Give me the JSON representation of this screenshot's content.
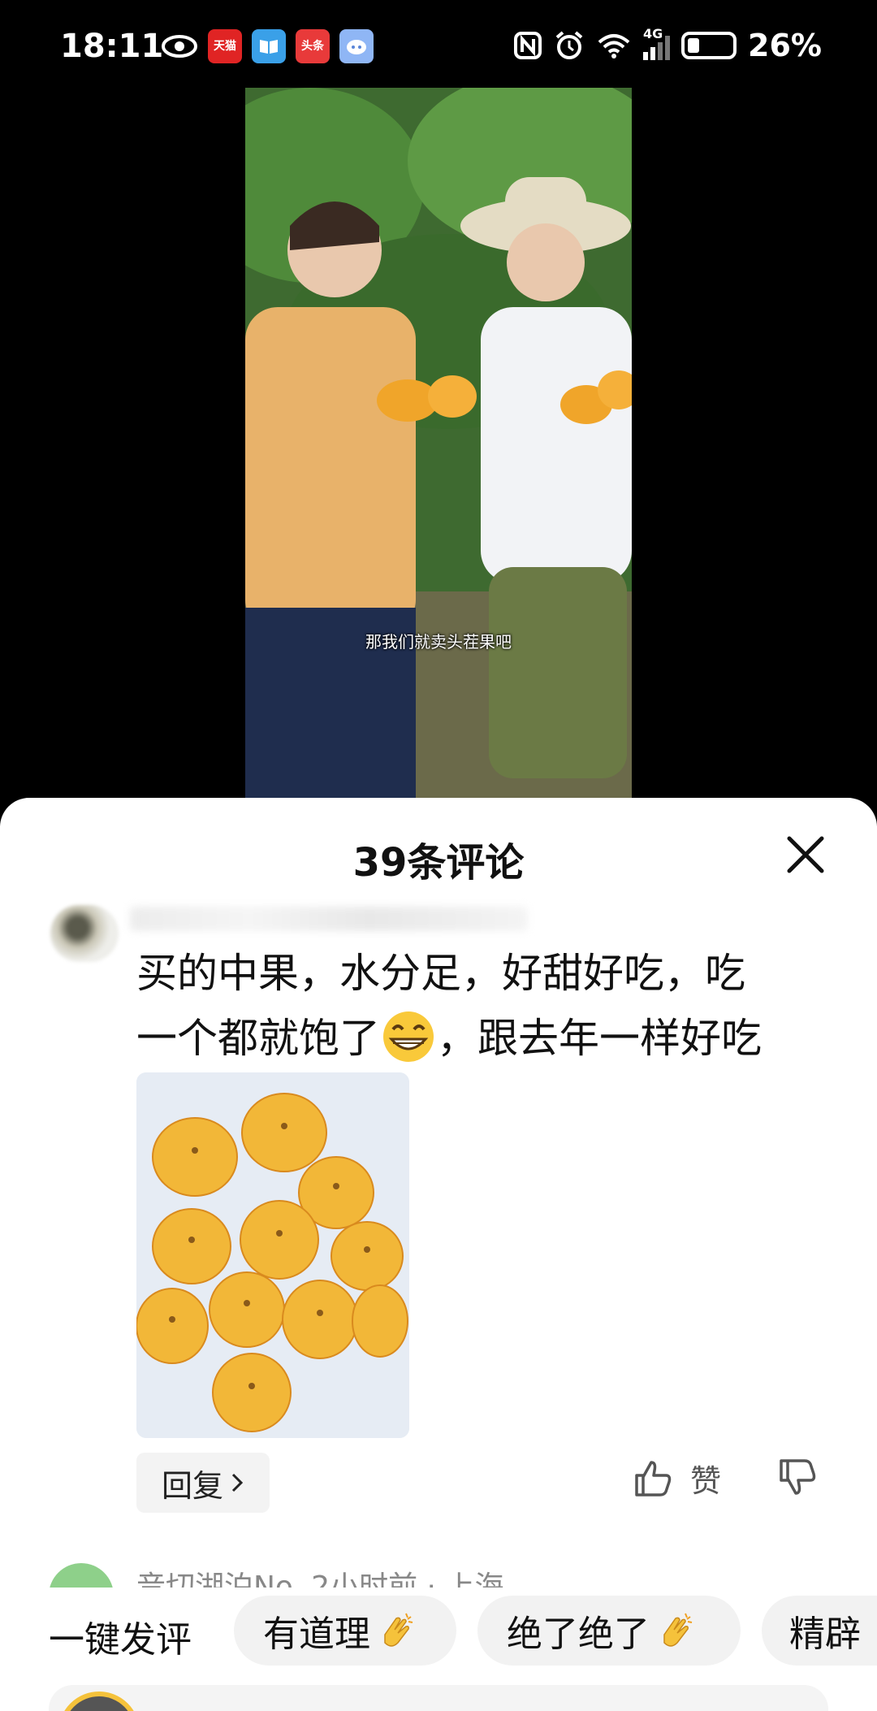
{
  "status_bar": {
    "time": "18:11",
    "apps": [
      {
        "name": "tmall-icon",
        "text": "天猫",
        "color": "#e02424"
      },
      {
        "name": "book-icon",
        "text": "",
        "color": "#3aa0e8"
      },
      {
        "name": "toutiao-icon",
        "text": "头条",
        "color": "#e83a3a"
      },
      {
        "name": "assistant-icon",
        "text": "",
        "color": "#8fb6f5"
      }
    ],
    "network": "4G",
    "battery": "26%",
    "battery_level": 0.26
  },
  "video": {
    "subtitle": "那我们就卖头茬果吧"
  },
  "comments_panel": {
    "title": "39条评论",
    "comment": {
      "text_line1": "买的中果，水分足，好甜好吃，吃",
      "text_line2_a": "一个都就饱了",
      "text_line2_b": "，跟去年一样好吃",
      "reply_label": "回复",
      "like_label": "赞"
    },
    "next_comment": {
      "meta": "音切湖泊No. 2小时前 · 上海"
    },
    "quick_replies": {
      "label": "一键发评",
      "chips": [
        "有道理",
        "绝了绝了",
        "精辟"
      ]
    }
  }
}
